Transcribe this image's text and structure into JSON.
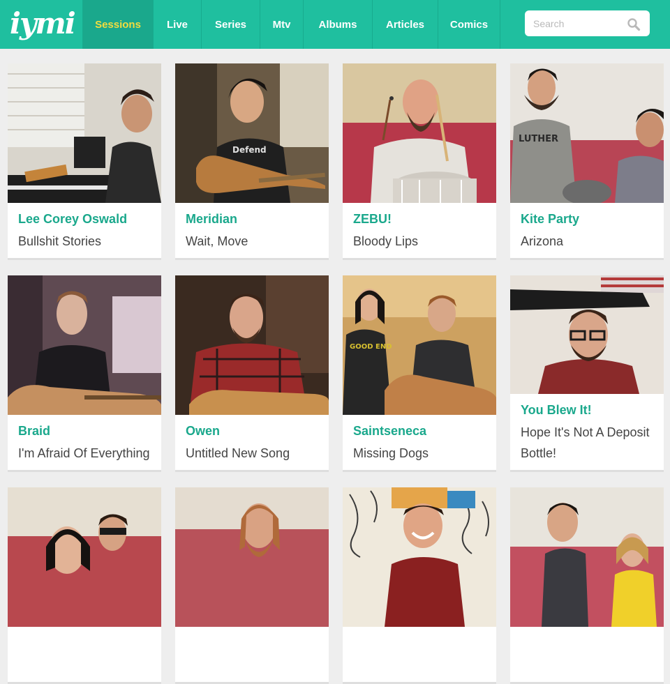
{
  "brand": {
    "logo_text": "iymi"
  },
  "nav": {
    "items": [
      {
        "label": "Sessions",
        "active": true
      },
      {
        "label": "Live"
      },
      {
        "label": "Series"
      },
      {
        "label": "Mtv"
      },
      {
        "label": "Albums"
      },
      {
        "label": "Articles"
      },
      {
        "label": "Comics"
      }
    ]
  },
  "search": {
    "placeholder": "Search",
    "value": ""
  },
  "colors": {
    "brand": "#1fbf9f",
    "active_nav_text": "#f3dc3f",
    "title_text": "#1aa88c"
  },
  "sessions": [
    {
      "artist": "Lee Corey Oswald",
      "song": "Bullshit Stories"
    },
    {
      "artist": "Meridian",
      "song": "Wait, Move"
    },
    {
      "artist": "ZEBU!",
      "song": "Bloody Lips"
    },
    {
      "artist": "Kite Party",
      "song": "Arizona"
    },
    {
      "artist": "Braid",
      "song": "I'm Afraid Of Everything"
    },
    {
      "artist": "Owen",
      "song": "Untitled New Song"
    },
    {
      "artist": "Saintseneca",
      "song": "Missing Dogs"
    },
    {
      "artist": "You Blew It!",
      "song": "Hope It's Not A Deposit Bottle!"
    },
    {
      "artist": "",
      "song": ""
    },
    {
      "artist": "",
      "song": ""
    },
    {
      "artist": "",
      "song": ""
    },
    {
      "artist": "",
      "song": ""
    }
  ]
}
